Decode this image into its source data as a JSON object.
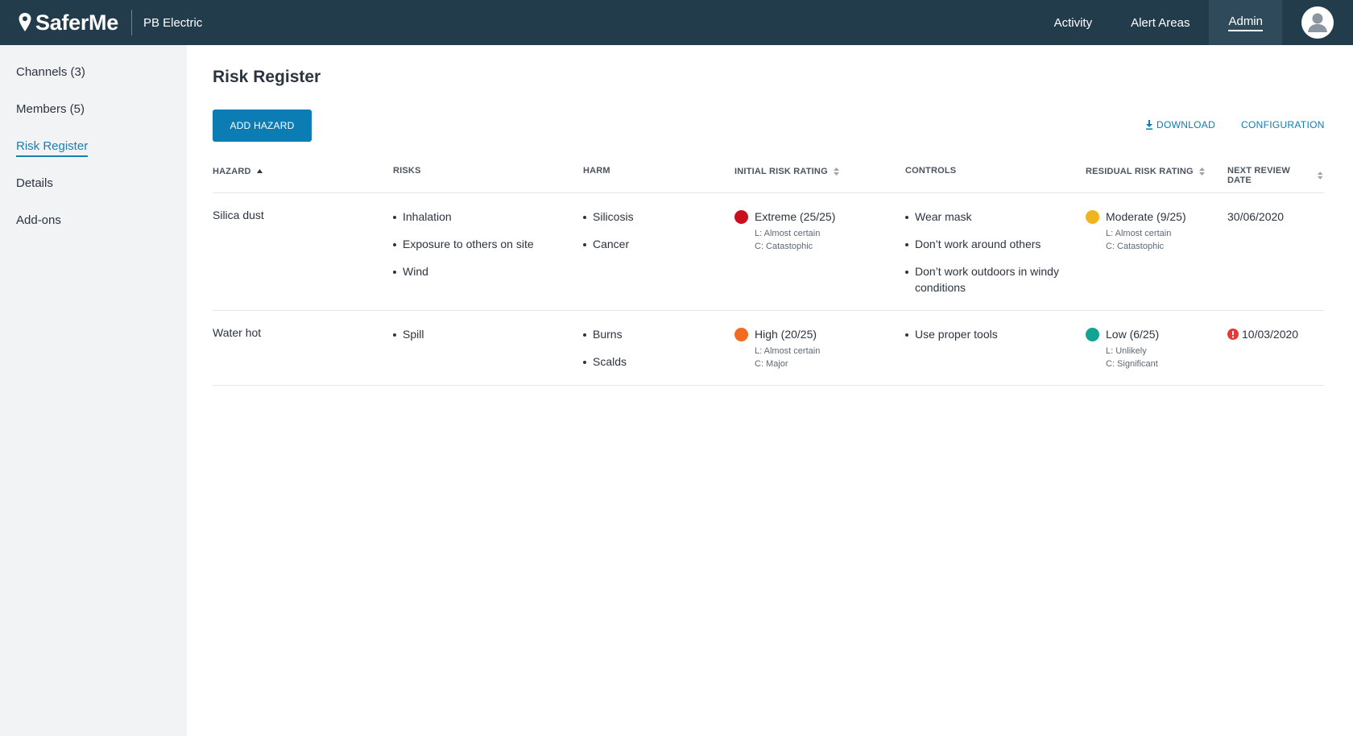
{
  "brand": {
    "name": "SaferMe",
    "org": "PB Electric"
  },
  "topnav": {
    "activity": "Activity",
    "alert_areas": "Alert Areas",
    "admin": "Admin"
  },
  "sidebar": {
    "items": [
      {
        "label": "Channels (3)"
      },
      {
        "label": "Members (5)"
      },
      {
        "label": "Risk Register"
      },
      {
        "label": "Details"
      },
      {
        "label": "Add-ons"
      }
    ]
  },
  "page": {
    "title": "Risk Register",
    "add_button": "ADD HAZARD",
    "download": "DOWNLOAD",
    "configuration": "CONFIGURATION"
  },
  "table": {
    "headers": {
      "hazard": "HAZARD",
      "risks": "RISKS",
      "harm": "HARM",
      "initial": "INITIAL RISK RATING",
      "controls": "CONTROLS",
      "residual": "RESIDUAL RISK RATING",
      "review": "NEXT REVIEW DATE"
    },
    "rows": [
      {
        "hazard": "Silica dust",
        "risks": [
          "Inhalation",
          "Exposure to others on site",
          "Wind"
        ],
        "harm": [
          "Silicosis",
          "Cancer"
        ],
        "initial": {
          "label": "Extreme (25/25)",
          "likelihood": "L: Almost certain",
          "consequence": "C: Catastophic",
          "color": "#c8101f"
        },
        "controls": [
          "Wear mask",
          "Don’t work around others",
          "Don’t work outdoors in windy conditions"
        ],
        "residual": {
          "label": "Moderate (9/25)",
          "likelihood": "L: Almost certain",
          "consequence": "C: Catastophic",
          "color": "#f0b41e"
        },
        "review_date": "30/06/2020",
        "overdue": false
      },
      {
        "hazard": "Water hot",
        "risks": [
          "Spill"
        ],
        "harm": [
          "Burns",
          "Scalds"
        ],
        "initial": {
          "label": "High (20/25)",
          "likelihood": "L: Almost certain",
          "consequence": "C: Major",
          "color": "#f26b21"
        },
        "controls": [
          "Use proper tools"
        ],
        "residual": {
          "label": "Low (6/25)",
          "likelihood": "L: Unlikely",
          "consequence": "C: Significant",
          "color": "#12a392"
        },
        "review_date": "10/03/2020",
        "overdue": true
      }
    ]
  },
  "colors": {
    "topbar": "#223c4b",
    "accent": "#0b7db4",
    "warning": "#e53935"
  }
}
